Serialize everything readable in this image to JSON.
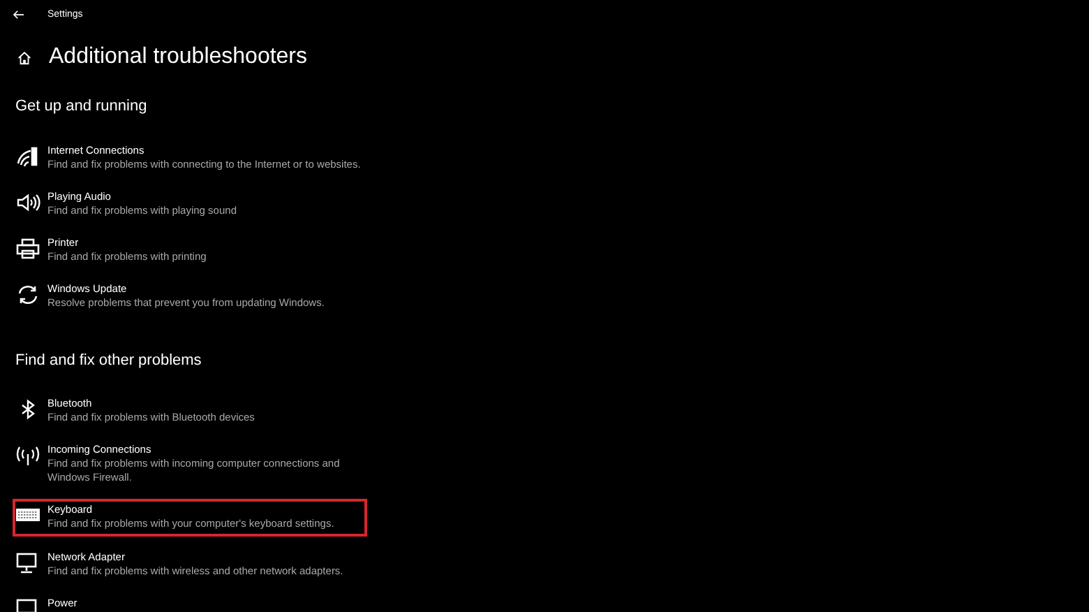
{
  "window": {
    "title": "Settings"
  },
  "page_title": "Additional troubleshooters",
  "sections": [
    {
      "heading": "Get up and running",
      "items": [
        {
          "kind": "wifi",
          "title": "Internet Connections",
          "description": "Find and fix problems with connecting to the Internet or to websites.",
          "highlighted": false
        },
        {
          "kind": "audio",
          "title": "Playing Audio",
          "description": "Find and fix problems with playing sound",
          "highlighted": false
        },
        {
          "kind": "printer",
          "title": "Printer",
          "description": "Find and fix problems with printing",
          "highlighted": false
        },
        {
          "kind": "update",
          "title": "Windows Update",
          "description": "Resolve problems that prevent you from updating Windows.",
          "highlighted": false
        }
      ]
    },
    {
      "heading": "Find and fix other problems",
      "items": [
        {
          "kind": "bluetooth",
          "title": "Bluetooth",
          "description": "Find and fix problems with Bluetooth devices",
          "highlighted": false
        },
        {
          "kind": "antenna",
          "title": "Incoming Connections",
          "description": "Find and fix problems with incoming computer connections and Windows Firewall.",
          "highlighted": false
        },
        {
          "kind": "keyboard",
          "title": "Keyboard",
          "description": "Find and fix problems with your computer's keyboard settings.",
          "highlighted": true
        },
        {
          "kind": "network",
          "title": "Network Adapter",
          "description": "Find and fix problems with wireless and other network adapters.",
          "highlighted": false
        },
        {
          "kind": "power",
          "title": "Power",
          "highlighted": false
        }
      ]
    }
  ]
}
